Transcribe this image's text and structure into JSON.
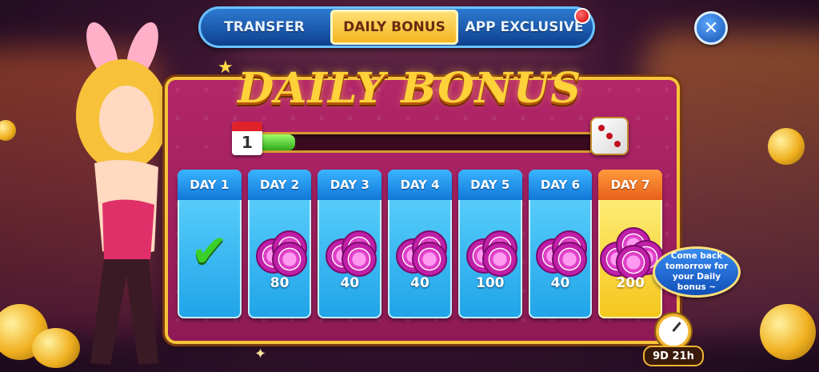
{
  "tabs": {
    "transfer": "TRANSFER",
    "daily_bonus": "DAILY BONUS",
    "app_exclusive": "APP EXCLUSIVE",
    "active": "DAILY BONUS"
  },
  "close_icon": "close-icon",
  "panel": {
    "title": "DAILY BONUS",
    "progress_day": "1",
    "progress_fraction": 0.15
  },
  "days": [
    {
      "label": "DAY 1",
      "value": "",
      "claimed": true
    },
    {
      "label": "DAY 2",
      "value": "80",
      "claimed": false
    },
    {
      "label": "DAY 3",
      "value": "40",
      "claimed": false
    },
    {
      "label": "DAY 4",
      "value": "40",
      "claimed": false
    },
    {
      "label": "DAY 5",
      "value": "100",
      "claimed": false
    },
    {
      "label": "DAY 6",
      "value": "40",
      "claimed": false
    },
    {
      "label": "DAY 7",
      "value": "200",
      "claimed": false
    }
  ],
  "bubble_text": "Come back tomorrow for your Daily bonus ~",
  "timer": "9D 21h",
  "colors": {
    "tab_active": "#f4b21a",
    "panel_bg": "#a2205f",
    "card_blue": "#1fa4e8",
    "card_gold": "#f5c61c",
    "progress_fill": "#2fa81a"
  }
}
